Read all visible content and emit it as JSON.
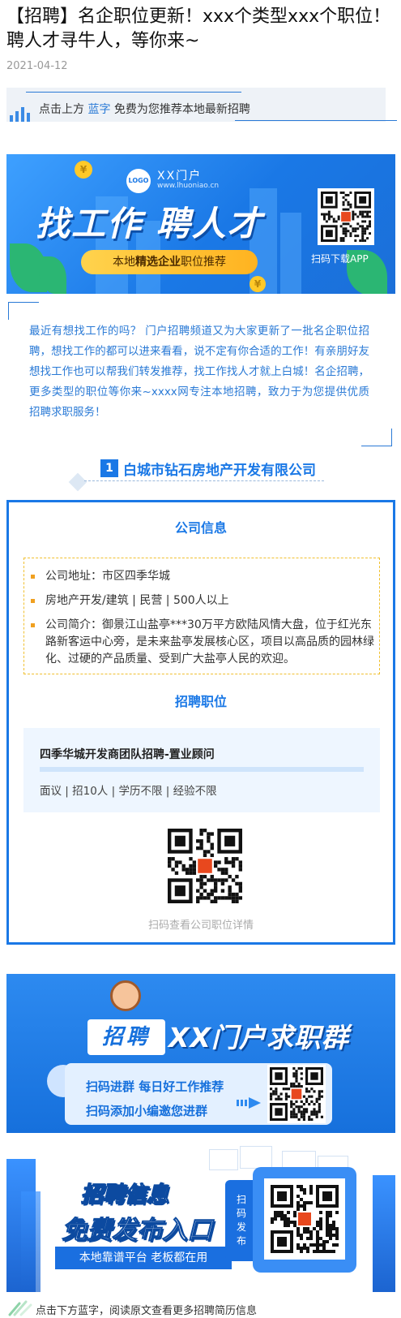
{
  "article": {
    "title": "【招聘】名企职位更新！xxx个类型xxx个职位！聘人才寻牛人，等你来~",
    "date": "2021-04-12"
  },
  "top_tip": {
    "prefix": "点击上方",
    "link": "蓝字",
    "suffix": "免费为您推荐本地最新招聘"
  },
  "banner1": {
    "logo": "LOGO",
    "brand": "XX门户",
    "url": "www.lhuoniao.cn",
    "headline": "找工作 聘人才",
    "pill_prefix": "本地",
    "pill_bold": "精选企业",
    "pill_suffix": "职位推荐",
    "qr_label": "扫码下载APP"
  },
  "intro": {
    "text": "最近有想找工作的吗？ 门户招聘频道又为大家更新了一批名企职位招聘，想找工作的都可以进来看看，说不定有你合适的工作！有亲朋好友想找工作也可以帮我们转发推荐，找工作找人才就上白城！名企招聘，更多类型的职位等你来~xxxx网专注本地招聘，致力于为您提供优质招聘求职服务！"
  },
  "section": {
    "number": "1",
    "company_name": "白城市钻石房地产开发有限公司"
  },
  "company_card": {
    "info_heading": "公司信息",
    "info_items": [
      "公司地址：市区四季华城",
      "房地产开发/建筑 | 民营 | 500人以上",
      "公司简介：御景江山盐亭***30万平方欧陆风情大盘，位于红光东路新客运中心旁，是未来盐亭发展核心区，项目以高品质的园林绿化、过硬的产品质量、受到广大盐亭人民的欢迎。"
    ],
    "jobs_heading": "招聘职位",
    "job": {
      "title": "四季华城开发商团队招聘-置业顾问",
      "meta": "面议 | 招10人 | 学历不限 | 经验不限"
    },
    "qr_label": "扫码查看公司职位详情"
  },
  "banner2": {
    "tag": "招聘",
    "title": "XX门户求职群",
    "line1": "扫码进群 每日好工作推荐",
    "line2": "扫码添加小编邀您进群"
  },
  "banner3": {
    "title1": "招聘信息",
    "title2": "免费发布入口",
    "subtitle": "本地靠谱平台 老板都在用",
    "tab": "扫码发布"
  },
  "footer_tip": {
    "text": "点击下方蓝字，阅读原文查看更多招聘简历信息"
  },
  "colors": {
    "accent": "#1a78e6",
    "text_blue": "#2a7ad6",
    "bullet": "#f0a020"
  }
}
